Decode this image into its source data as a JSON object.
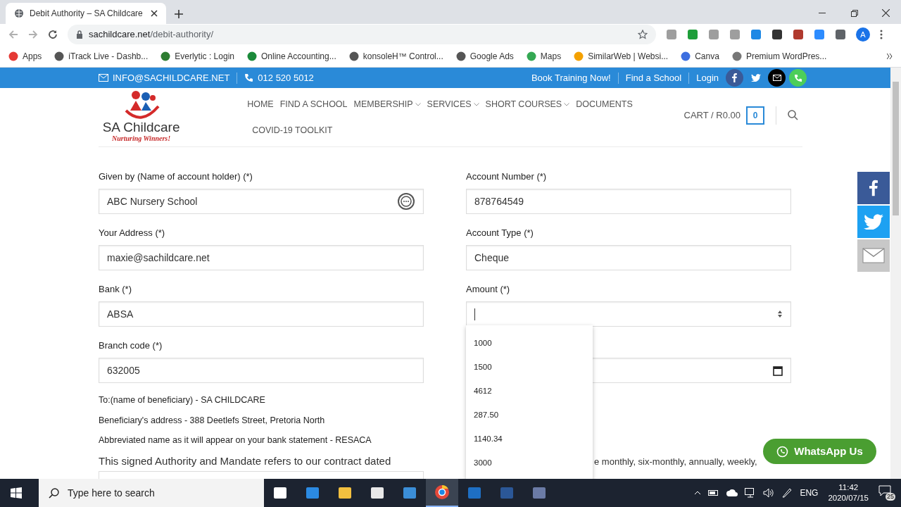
{
  "browser": {
    "tab_title": "Debit Authority – SA Childcare",
    "url_host": "sachildcare.net",
    "url_path": "/debit-authority/",
    "bookmarks": [
      {
        "label": "Apps",
        "color": "#e53935"
      },
      {
        "label": "iTrack Live - Dashb...",
        "color": "#555555"
      },
      {
        "label": "Everlytic : Login",
        "color": "#2e7d32"
      },
      {
        "label": "Online Accounting...",
        "color": "#1b8a3a"
      },
      {
        "label": "konsoleH™ Control...",
        "color": "#555555"
      },
      {
        "label": "Google Ads",
        "color": "#555555"
      },
      {
        "label": "Maps",
        "color": "#34a853"
      },
      {
        "label": "SimilarWeb | Websi...",
        "color": "#f4a100"
      },
      {
        "label": "Canva",
        "color": "#3d6fe0"
      },
      {
        "label": "Premium WordPres...",
        "color": "#777777"
      }
    ],
    "extensions": [
      {
        "color": "#9e9e9e"
      },
      {
        "color": "#1e9e3a"
      },
      {
        "color": "#9e9e9e"
      },
      {
        "color": "#9e9e9e"
      },
      {
        "color": "#1e88e5"
      },
      {
        "color": "#333333"
      },
      {
        "color": "#b03a2e"
      },
      {
        "color": "#2d8cff"
      },
      {
        "color": "#5f6368"
      }
    ],
    "profile_initial": "A"
  },
  "topbar": {
    "email": "INFO@SACHILDCARE.NET",
    "phone": "012 520 5012",
    "links": [
      "Book Training Now!",
      "Find a School",
      "Login"
    ]
  },
  "header": {
    "logo_title": "SA Childcare",
    "logo_tagline": "Nurturing Winners!",
    "nav": [
      {
        "label": "HOME",
        "dropdown": false
      },
      {
        "label": "FIND A SCHOOL",
        "dropdown": false
      },
      {
        "label": "MEMBERSHIP",
        "dropdown": true
      },
      {
        "label": "SERVICES",
        "dropdown": true
      },
      {
        "label": "SHORT COURSES",
        "dropdown": true
      },
      {
        "label": "DOCUMENTS",
        "dropdown": false
      },
      {
        "label": "COVID-19 TOOLKIT",
        "dropdown": false
      }
    ],
    "cart_label": "CART / R0.00",
    "cart_count": "0"
  },
  "form": {
    "left": [
      {
        "label": "Given by (Name of account holder) (*)",
        "value": "ABC Nursery School"
      },
      {
        "label": "Your Address (*)",
        "value": "maxie@sachildcare.net"
      },
      {
        "label": "Bank (*)",
        "value": "ABSA"
      },
      {
        "label": "Branch code (*)",
        "value": "632005"
      }
    ],
    "right": [
      {
        "label": "Account Number (*)",
        "value": "878764549",
        "kind": "text"
      },
      {
        "label": "Account Type (*)",
        "value": "Cheque",
        "kind": "text"
      },
      {
        "label": "Amount (*)",
        "kind": "number"
      },
      {
        "kind": "date"
      }
    ],
    "notes": [
      "To:(name of beneficiary) - SA CHILDCARE",
      "Beneficiary's address - 388 Deetlefs Street, Pretoria North",
      "Abbreviated name as it will appear on your bank statement - RESACA"
    ],
    "contract_text": "This signed Authority and Mandate refers to our contract dated",
    "right_text": "e monthly, six-monthly, annually, weekly,",
    "amount_options": [
      "1000",
      "1500",
      "4612",
      "287.50",
      "1140.34",
      "3000"
    ]
  },
  "whatsapp": "WhatsApp Us",
  "taskbar": {
    "search_placeholder": "Type here to search",
    "language": "ENG",
    "time": "11:42",
    "date": "2020/07/15",
    "notifications": "25"
  }
}
